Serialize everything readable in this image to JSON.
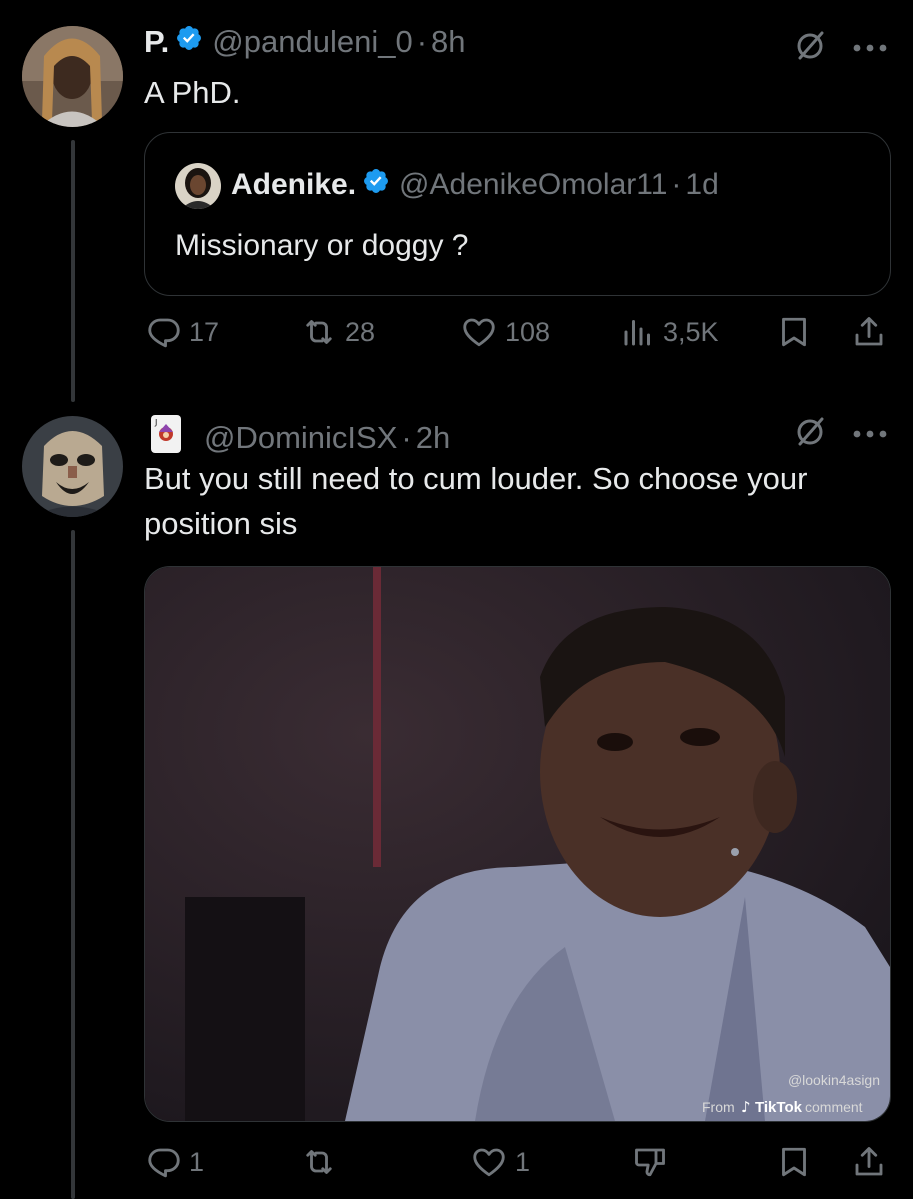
{
  "tweet1": {
    "display_name": "P.",
    "handle": "@panduleni_0",
    "dot": "·",
    "time": "8h",
    "text": "A PhD.",
    "quote": {
      "display_name": "Adenike.",
      "handle": "@AdenikeOmolar11",
      "dot": "·",
      "time": "1d",
      "text": "Missionary or doggy ?"
    },
    "actions": {
      "replies": "17",
      "reposts": "28",
      "likes": "108",
      "views": "3,5K"
    }
  },
  "tweet2": {
    "display_name": "",
    "handle": "@DominicISX",
    "dot": "·",
    "time": "2h",
    "text": "But you still need to cum louder. So choose your position sis",
    "media": {
      "watermark_handle": "@lookin4asign",
      "watermark_from": "From",
      "watermark_brand": "TikTok",
      "watermark_suffix": "comment"
    },
    "actions": {
      "replies": "1",
      "reposts": "",
      "likes": "1"
    }
  },
  "colors": {
    "background": "#000000",
    "text_primary": "#e7e9ea",
    "text_secondary": "#71767b",
    "verified_blue": "#1d9bf0",
    "border": "#2f3336"
  },
  "icons": [
    "verified-badge-icon",
    "grok-icon",
    "more-icon",
    "reply-icon",
    "repost-icon",
    "like-icon",
    "views-icon",
    "bookmark-icon",
    "share-icon",
    "dislike-icon",
    "tiktok-icon"
  ]
}
